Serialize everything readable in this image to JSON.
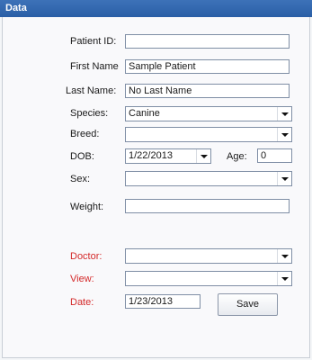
{
  "window": {
    "title": "Data"
  },
  "form": {
    "patient_id": {
      "label": "Patient ID:",
      "value": ""
    },
    "first_name": {
      "label": "First Name",
      "value": "Sample Patient"
    },
    "last_name": {
      "label": "Last Name:",
      "value": "No Last Name"
    },
    "species": {
      "label": "Species:",
      "value": "Canine"
    },
    "breed": {
      "label": "Breed:",
      "value": ""
    },
    "dob": {
      "label": "DOB:",
      "value": "1/22/2013"
    },
    "age": {
      "label": "Age:",
      "value": "0"
    },
    "sex": {
      "label": "Sex:",
      "value": ""
    },
    "weight": {
      "label": "Weight:",
      "value": ""
    },
    "doctor": {
      "label": "Doctor:",
      "value": ""
    },
    "view": {
      "label": "View:",
      "value": ""
    },
    "date": {
      "label": "Date:",
      "value": "1/23/2013"
    }
  },
  "actions": {
    "save_label": "Save"
  },
  "colors": {
    "title_bar": "#2a5ea6",
    "required_label": "#d42a2a"
  }
}
